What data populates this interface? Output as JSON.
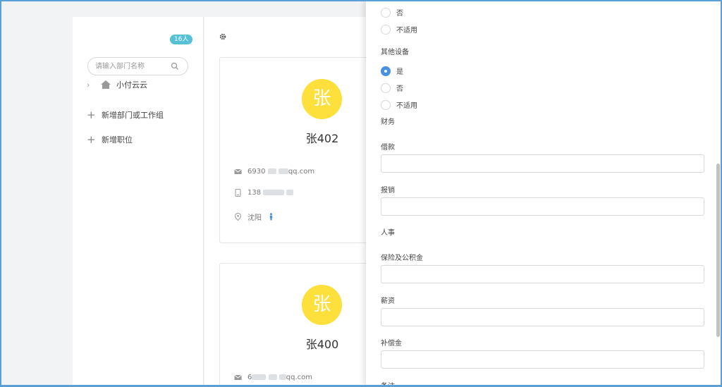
{
  "sidebar": {
    "count_badge": "16人",
    "search_placeholder": "请输入部门名称",
    "tree_root": "小付云云",
    "actions": [
      "新增部门或工作组",
      "新增职位"
    ]
  },
  "cards": [
    {
      "avatar_char": "张",
      "name": "张402",
      "email_prefix": "6930",
      "email_suffix": "qq.com",
      "phone_prefix": "138",
      "location": "沈阳"
    },
    {
      "avatar_char": "张",
      "name": "张400",
      "email_prefix": "6",
      "email_suffix": "qq.com"
    }
  ],
  "drawer": {
    "prev_options": [
      "否",
      "不适用"
    ],
    "other_device": {
      "title": "其他设备",
      "options": [
        "是",
        "否",
        "不适用"
      ],
      "selected": "是"
    },
    "finance": {
      "title": "财务",
      "fields": [
        {
          "label": "借款",
          "value": ""
        },
        {
          "label": "报销",
          "value": ""
        }
      ]
    },
    "hr": {
      "title": "人事",
      "fields": [
        {
          "label": "保险及公积金",
          "value": ""
        },
        {
          "label": "薪资",
          "value": ""
        },
        {
          "label": "补偿金",
          "value": ""
        }
      ]
    },
    "remark_label": "备注"
  },
  "colors": {
    "accent": "#4a90e2",
    "badge": "#55c0d6",
    "avatar": "#fde03b",
    "frame": "#5a9fd6"
  }
}
